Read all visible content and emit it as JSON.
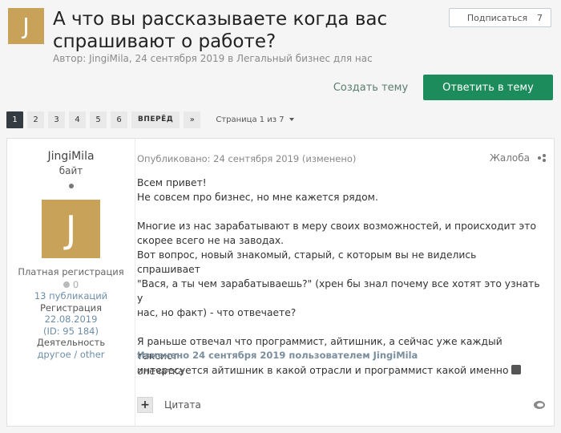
{
  "topic": {
    "avatar_letter": "J",
    "title": "А что вы рассказываете когда вас спрашивают о работе?",
    "meta_prefix": "Автор: ",
    "author": "JingiMila",
    "meta_sep": ", ",
    "date": "24 сентября 2019",
    "meta_in": " в ",
    "forum": "Легальный бизнес для нас",
    "follow_label": "Подписаться",
    "follow_count": "7"
  },
  "actions": {
    "create_topic": "Создать тему",
    "reply": "Ответить в тему"
  },
  "pagination": {
    "pages": [
      "1",
      "2",
      "3",
      "4",
      "5",
      "6"
    ],
    "active": "1",
    "next": "ВПЕРЁД",
    "last": "»",
    "info": "Страница 1 из 7"
  },
  "author": {
    "name": "JingiMila",
    "rank": "байт",
    "avatar_letter": "J",
    "group": "Платная регистрация",
    "reputation": "0",
    "posts": "13 публикаций",
    "joined_label": "Регистрация",
    "joined_date": "22.08.2019",
    "id": "(ID: 95 184)",
    "activity_label": "Деятельность",
    "activity_value": "другое / other"
  },
  "post": {
    "published": "Опубликовано: 24 сентября 2019 (изменено)",
    "report": "Жалоба",
    "p1": "Всем привет!\nНе совсем про бизнес, но мне кажется рядом.",
    "p2": "Многие из нас зарабатывают в меру своих возможностей, и происходит это\nскорее всего не на заводах.\nВот вопрос, новый знакомый, старый, с которым вы не виделись спрашивает\n\"Вася, а ты чем зарабатываешь?\" (хрен бы знал почему все хотят это узнать у\nнас, но факт) - что отвечаете?",
    "p3": "Я раньше отвечал что программист, айтишник, а сейчас уже каждый таксист\nинтересуется айтишник в какой отрасли и программист какой именно",
    "edited": "Изменено 24 сентября 2019 пользователем JingiMila",
    "edit_reason": "опечатка",
    "quote": "Цитата",
    "plus": "+"
  },
  "colors": {
    "reply_button": "#1c8c5c",
    "avatar": "#c9a25a",
    "active_page": "#353c41"
  }
}
